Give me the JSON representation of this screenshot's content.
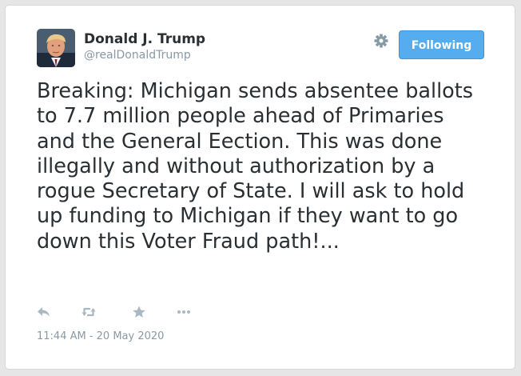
{
  "tweet": {
    "author": {
      "display_name": "Donald J. Trump",
      "handle": "@realDonaldTrump"
    },
    "follow_button_label": "Following",
    "text": "Breaking: Michigan sends absentee ballots to 7.7 million people ahead of Primaries and the General Eection. This was done illegally and without authorization by a rogue Secretary of State. I will ask to hold up funding to Michigan if they want to go down this Voter Fraud path!...",
    "timestamp": "11:44 AM - 20 May 2020"
  },
  "icons": {
    "settings": "gear-icon",
    "reply": "reply-icon",
    "retweet": "retweet-icon",
    "favorite": "star-icon",
    "more": "more-icon"
  },
  "colors": {
    "follow_button": "#55acee",
    "text_primary": "#292f33",
    "text_secondary": "#8899a6",
    "action_icons": "#aab8c2"
  }
}
